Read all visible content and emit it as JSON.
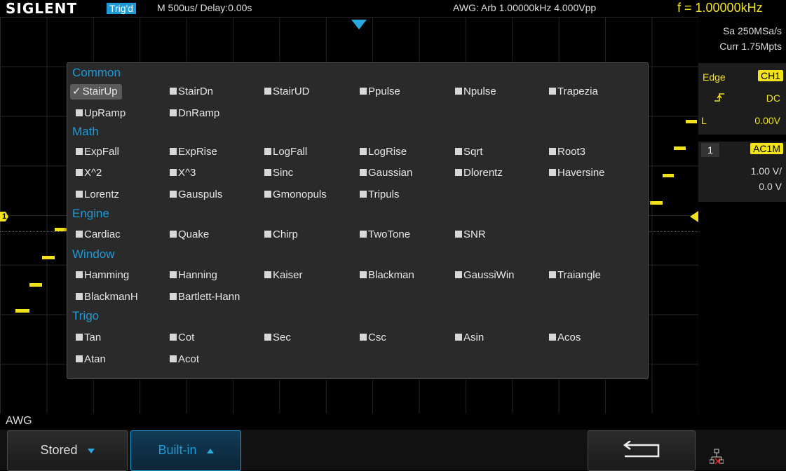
{
  "top": {
    "brand": "SIGLENT",
    "trig_status": "Trig'd",
    "timebase": "M 500us/  Delay:0.00s",
    "awg": "AWG: Arb  1.00000kHz  4.000Vpp",
    "freq": "f = 1.00000kHz"
  },
  "right": {
    "sa": "Sa 250MSa/s",
    "curr": "Curr 1.75Mpts",
    "trig_type": "Edge",
    "trig_src": "CH1",
    "coupling": "DC",
    "level_label": "L",
    "level": "0.00V",
    "ch_num": "1",
    "ch_coupling": "AC1M",
    "vdiv": "1.00 V/",
    "offset": "0.0 V"
  },
  "channel_marker": "1",
  "menu": {
    "categories": {
      "common": "Common",
      "math": "Math",
      "engine": "Engine",
      "window": "Window",
      "trigo": "Trigo"
    },
    "items": {
      "stairup": "StairUp",
      "stairdn": "StairDn",
      "stairud": "StairUD",
      "ppulse": "Ppulse",
      "npulse": "Npulse",
      "trapezia": "Trapezia",
      "upramp": "UpRamp",
      "dnramp": "DnRamp",
      "expfall": "ExpFall",
      "exprise": "ExpRise",
      "logfall": "LogFall",
      "logrise": "LogRise",
      "sqrt": "Sqrt",
      "root3": "Root3",
      "x2": "X^2",
      "x3": "X^3",
      "sinc": "Sinc",
      "gaussian": "Gaussian",
      "dlorentz": "Dlorentz",
      "haversine": "Haversine",
      "lorentz": "Lorentz",
      "gauspuls": "Gauspuls",
      "gmonopuls": "Gmonopuls",
      "tripuls": "Tripuls",
      "cardiac": "Cardiac",
      "quake": "Quake",
      "chirp": "Chirp",
      "twotone": "TwoTone",
      "snr": "SNR",
      "hamming": "Hamming",
      "hanning": "Hanning",
      "kaiser": "Kaiser",
      "blackman": "Blackman",
      "gaussiwin": "GaussiWin",
      "traiangle": "Traiangle",
      "blackmanh": "BlackmanH",
      "bartletthann": "Bartlett-Hann",
      "tan": "Tan",
      "cot": "Cot",
      "sec": "Sec",
      "csc": "Csc",
      "asin": "Asin",
      "acos": "Acos",
      "atan": "Atan",
      "acot": "Acot"
    },
    "selected": "StairUp"
  },
  "bottom": {
    "title": "AWG",
    "stored": "Stored",
    "builtin": "Built-in"
  },
  "colors": {
    "accent": "#1e9ad6",
    "trace": "#f2e21e"
  }
}
